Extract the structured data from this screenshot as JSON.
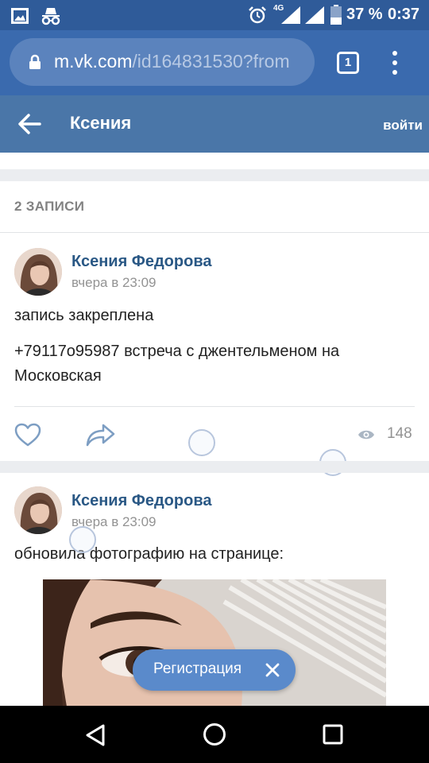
{
  "status_bar": {
    "network": "4G",
    "battery": "37 %",
    "time": "0:37",
    "icons": [
      "image-icon",
      "incognito-icon",
      "alarm-icon",
      "signal-icon",
      "signal-icon",
      "battery-icon"
    ]
  },
  "browser": {
    "url_domain": "m.vk.com",
    "url_path": "/id164831530?from",
    "tab_count": "1",
    "icons": [
      "lock-icon",
      "more-vert-icon"
    ]
  },
  "header": {
    "title": "Ксения",
    "login": "войти",
    "accent": "#4a76a8"
  },
  "feed": {
    "count_label": "2 ЗАПИСИ",
    "posts": [
      {
        "author": "Ксения Федорова",
        "time": "вчера в 23:09",
        "pinned": "запись закреплена",
        "text": "+79117о95987 встреча с джентельменом на Московская",
        "views": "148"
      },
      {
        "author": "Ксения Федорова",
        "time": "вчера в 23:09",
        "text": "обновила фотографию на странице:"
      }
    ]
  },
  "register": {
    "label": "Регистрация"
  },
  "nav": {
    "icons": [
      "back-triangle-icon",
      "home-circle-icon",
      "recents-square-icon"
    ]
  }
}
